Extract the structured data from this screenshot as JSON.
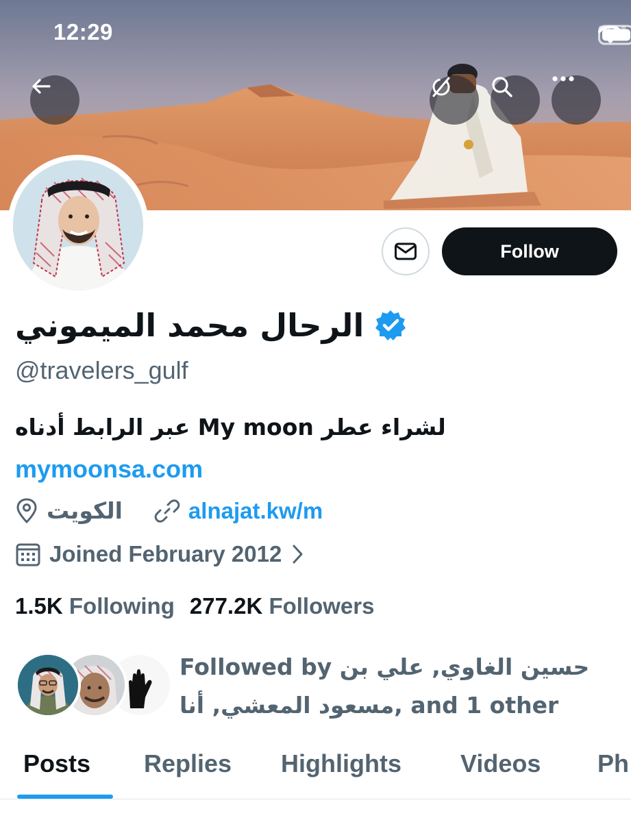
{
  "status_bar": {
    "time": "12:29"
  },
  "profile": {
    "display_name": "الرحال محمد الميموني",
    "handle": "@travelers_gulf",
    "bio": "لشراء عطر My moon عبر الرابط أدناه",
    "bio_link": "mymoonsa.com",
    "location": "الكويت",
    "website": "alnajat.kw/m",
    "joined": "Joined February 2012",
    "following_count": "1.5K",
    "following_label": "Following",
    "followers_count": "277.2K",
    "followers_label": "Followers",
    "followed_by_text": "Followed by حسين الغاوي, علي بن مسعود المعشي, أنا, and 1 other"
  },
  "actions": {
    "follow_label": "Follow"
  },
  "tabs": [
    {
      "label": "Posts",
      "active": true
    },
    {
      "label": "Replies",
      "active": false
    },
    {
      "label": "Highlights",
      "active": false
    },
    {
      "label": "Videos",
      "active": false
    },
    {
      "label": "Ph",
      "active": false
    }
  ],
  "colors": {
    "accent": "#1d9bf0",
    "follow_button": "#0f1419",
    "muted_text": "#536471",
    "verified": "#1d9bf0"
  },
  "icons": {
    "back": "arrow-left-icon",
    "grok": "grok-icon",
    "search": "search-icon",
    "more": "more-icon",
    "message": "envelope-icon",
    "verified": "verified-badge-icon",
    "location": "location-pin-icon",
    "website": "link-icon",
    "joined": "calendar-icon",
    "chevron": "chevron-right-icon"
  }
}
